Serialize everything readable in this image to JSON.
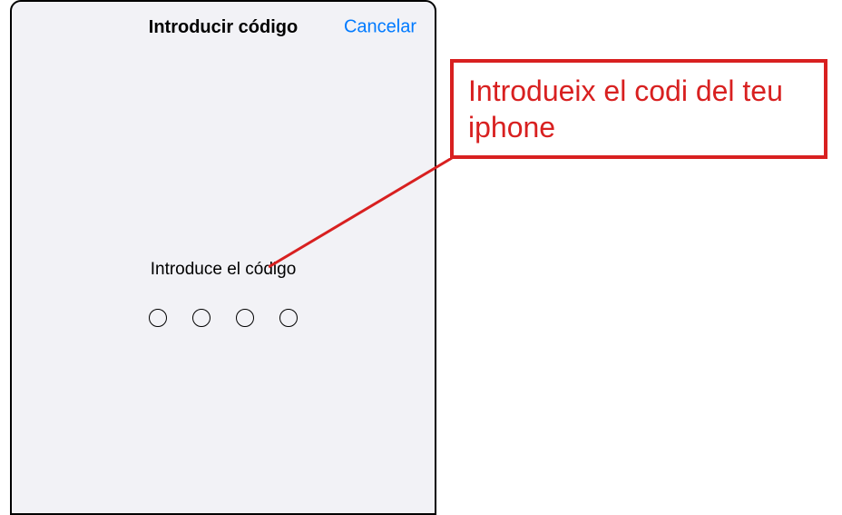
{
  "modal": {
    "title": "Introducir código",
    "cancel_label": "Cancelar",
    "passcode_prompt": "Introduce el código",
    "passcode_length": 4
  },
  "annotation": {
    "text": "Introdueix el codi del teu iphone",
    "accent_color": "#d82020"
  }
}
